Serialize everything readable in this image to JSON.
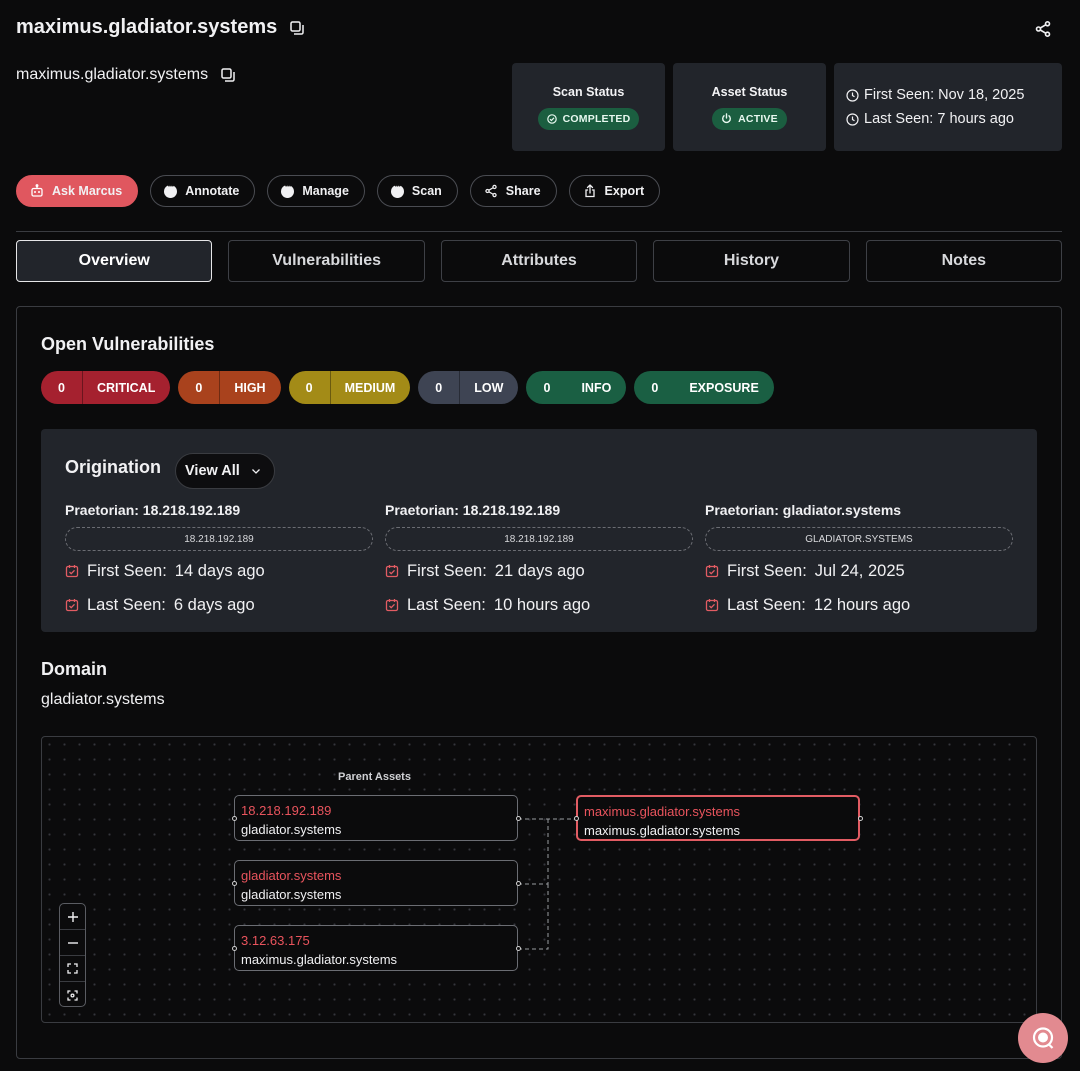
{
  "header": {
    "title": "maximus.gladiator.systems",
    "subtitle": "maximus.gladiator.systems"
  },
  "scan_status": {
    "label": "Scan Status",
    "value": "COMPLETED"
  },
  "asset_status": {
    "label": "Asset Status",
    "value": "ACTIVE"
  },
  "seen": {
    "first": "First Seen: Nov 18, 2025",
    "last": "Last Seen: 7 hours ago"
  },
  "actions": [
    "Ask Marcus",
    "Annotate",
    "Manage",
    "Scan",
    "Share",
    "Export"
  ],
  "tabs": [
    "Overview",
    "Vulnerabilities",
    "Attributes",
    "History",
    "Notes"
  ],
  "vulns": {
    "title": "Open Vulnerabilities",
    "badges": [
      {
        "count": "0",
        "label": "CRITICAL",
        "color": "#a5212f"
      },
      {
        "count": "0",
        "label": "HIGH",
        "color": "#a9421d"
      },
      {
        "count": "0",
        "label": "MEDIUM",
        "color": "#a38b17"
      },
      {
        "count": "0",
        "label": "LOW",
        "color": "#3e4453"
      },
      {
        "count": "0",
        "label": "INFO",
        "color": "#1a5f43"
      },
      {
        "count": "0",
        "label": "EXPOSURE",
        "color": "#1a5f43"
      }
    ]
  },
  "origination": {
    "title": "Origination",
    "view_all": "View All",
    "first_label": "First Seen:",
    "last_label": "Last Seen:",
    "items": [
      {
        "source": "Praetorian: 18.218.192.189",
        "chip": "18.218.192.189",
        "first": "14 days ago",
        "last": "6 days ago"
      },
      {
        "source": "Praetorian: 18.218.192.189",
        "chip": "18.218.192.189",
        "first": "21 days ago",
        "last": "10 hours ago"
      },
      {
        "source": "Praetorian: gladiator.systems",
        "chip": "GLADIATOR.SYSTEMS",
        "first": "Jul 24, 2025",
        "last": "12 hours ago"
      }
    ]
  },
  "domain": {
    "title": "Domain",
    "value": "gladiator.systems"
  },
  "graph": {
    "parent_label": "Parent Assets",
    "parents": [
      {
        "top": "18.218.192.189",
        "bottom": "gladiator.systems"
      },
      {
        "top": "gladiator.systems",
        "bottom": "gladiator.systems"
      },
      {
        "top": "3.12.63.175",
        "bottom": "maximus.gladiator.systems"
      }
    ],
    "target": {
      "top": "maximus.gladiator.systems",
      "bottom": "maximus.gladiator.systems"
    }
  },
  "colors": {
    "accent": "#e0575f",
    "green": "#1b5e40",
    "panel": "#22252b"
  }
}
